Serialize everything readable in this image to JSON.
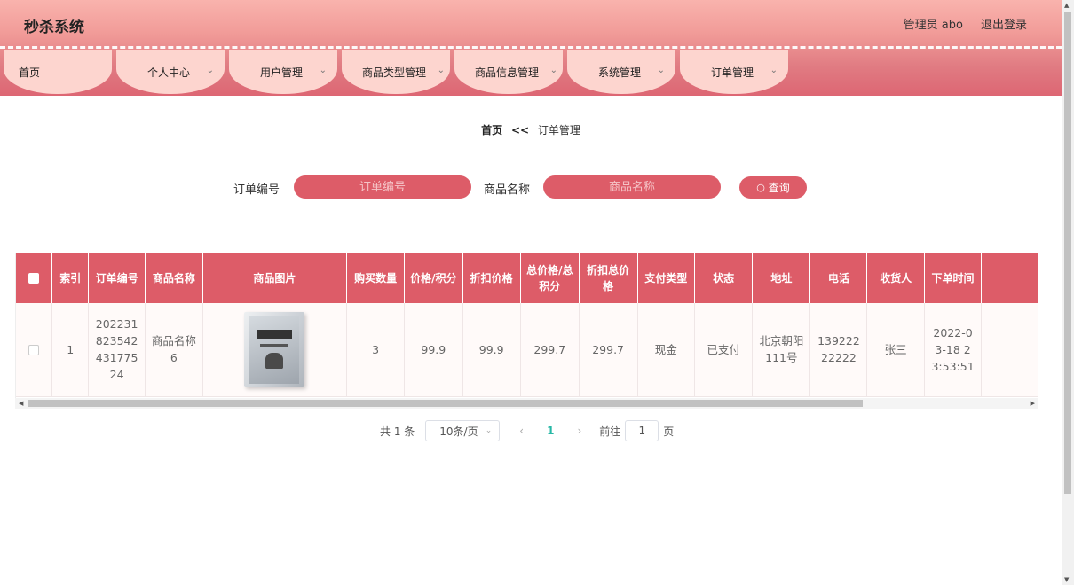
{
  "header": {
    "title": "秒杀系统",
    "user_label": "管理员 abo",
    "logout_label": "退出登录"
  },
  "nav": [
    {
      "label": "首页",
      "has_dropdown": false
    },
    {
      "label": "个人中心",
      "has_dropdown": true
    },
    {
      "label": "用户管理",
      "has_dropdown": true
    },
    {
      "label": "商品类型管理",
      "has_dropdown": true
    },
    {
      "label": "商品信息管理",
      "has_dropdown": true
    },
    {
      "label": "系统管理",
      "has_dropdown": true
    },
    {
      "label": "订单管理",
      "has_dropdown": true
    }
  ],
  "breadcrumb": {
    "home": "首页",
    "separator": "<<",
    "current": "订单管理"
  },
  "search": {
    "order_no_label": "订单编号",
    "order_no_placeholder": "订单编号",
    "product_name_label": "商品名称",
    "product_name_placeholder": "商品名称",
    "query_label": "查询"
  },
  "table": {
    "headers": [
      "索引",
      "订单编号",
      "商品名称",
      "商品图片",
      "购买数量",
      "价格/积分",
      "折扣价格",
      "总价格/总积分",
      "折扣总价格",
      "支付类型",
      "状态",
      "地址",
      "电话",
      "收货人",
      "下单时间"
    ],
    "rows": [
      {
        "index": "1",
        "order_no": "20223182354243177524",
        "product_name": "商品名称6",
        "image": "book-cover-image",
        "quantity": "3",
        "price": "99.9",
        "discount_price": "99.9",
        "total_price": "299.7",
        "discount_total": "299.7",
        "pay_type": "现金",
        "status": "已支付",
        "address": "北京朝阳111号",
        "phone": "13922222222",
        "receiver": "张三",
        "order_time": "2022-03-18 23:53:51"
      }
    ]
  },
  "pagination": {
    "total_text": "共 1 条",
    "page_size": "10条/页",
    "current_page": "1",
    "goto_label": "前往",
    "goto_value": "1",
    "page_suffix": "页"
  },
  "colors": {
    "accent": "#dd5c68",
    "nav_tab": "#fdd5cf",
    "page_active": "#27b8a6"
  }
}
